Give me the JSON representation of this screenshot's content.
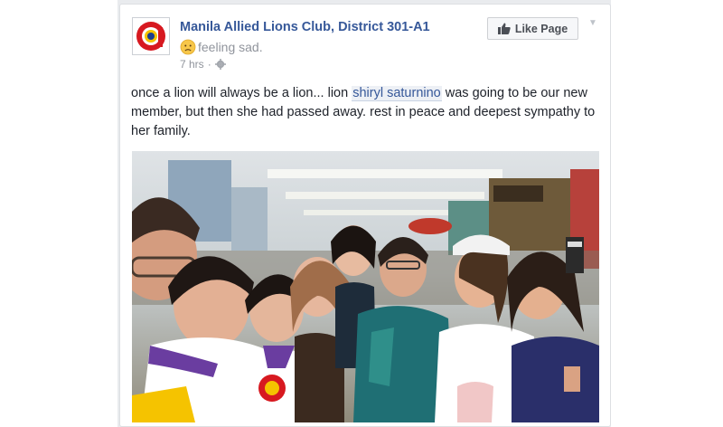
{
  "post": {
    "page_name": "Manila Allied Lions Club, District 301-A1",
    "feeling": "feeling sad.",
    "timestamp": "7 hrs",
    "separator": "·",
    "privacy_icon": "gear-icon",
    "like_button": "Like Page",
    "menu_icon": "chevron-down-icon",
    "text_before": "once a lion will always be a lion... lion ",
    "mention": "shiryl saturnino",
    "text_after": " was going to be our new member, but then she had passed away. rest in peace and deepest sympathy to her family.",
    "photo_icon": "group-selfie-photo",
    "avatar_icon": "lions-club-logo-icon"
  },
  "colors": {
    "link": "#365899",
    "secondary_text": "#90949c",
    "body_text": "#1d2129",
    "logo_red": "#d71920",
    "logo_yellow": "#f5c300"
  }
}
